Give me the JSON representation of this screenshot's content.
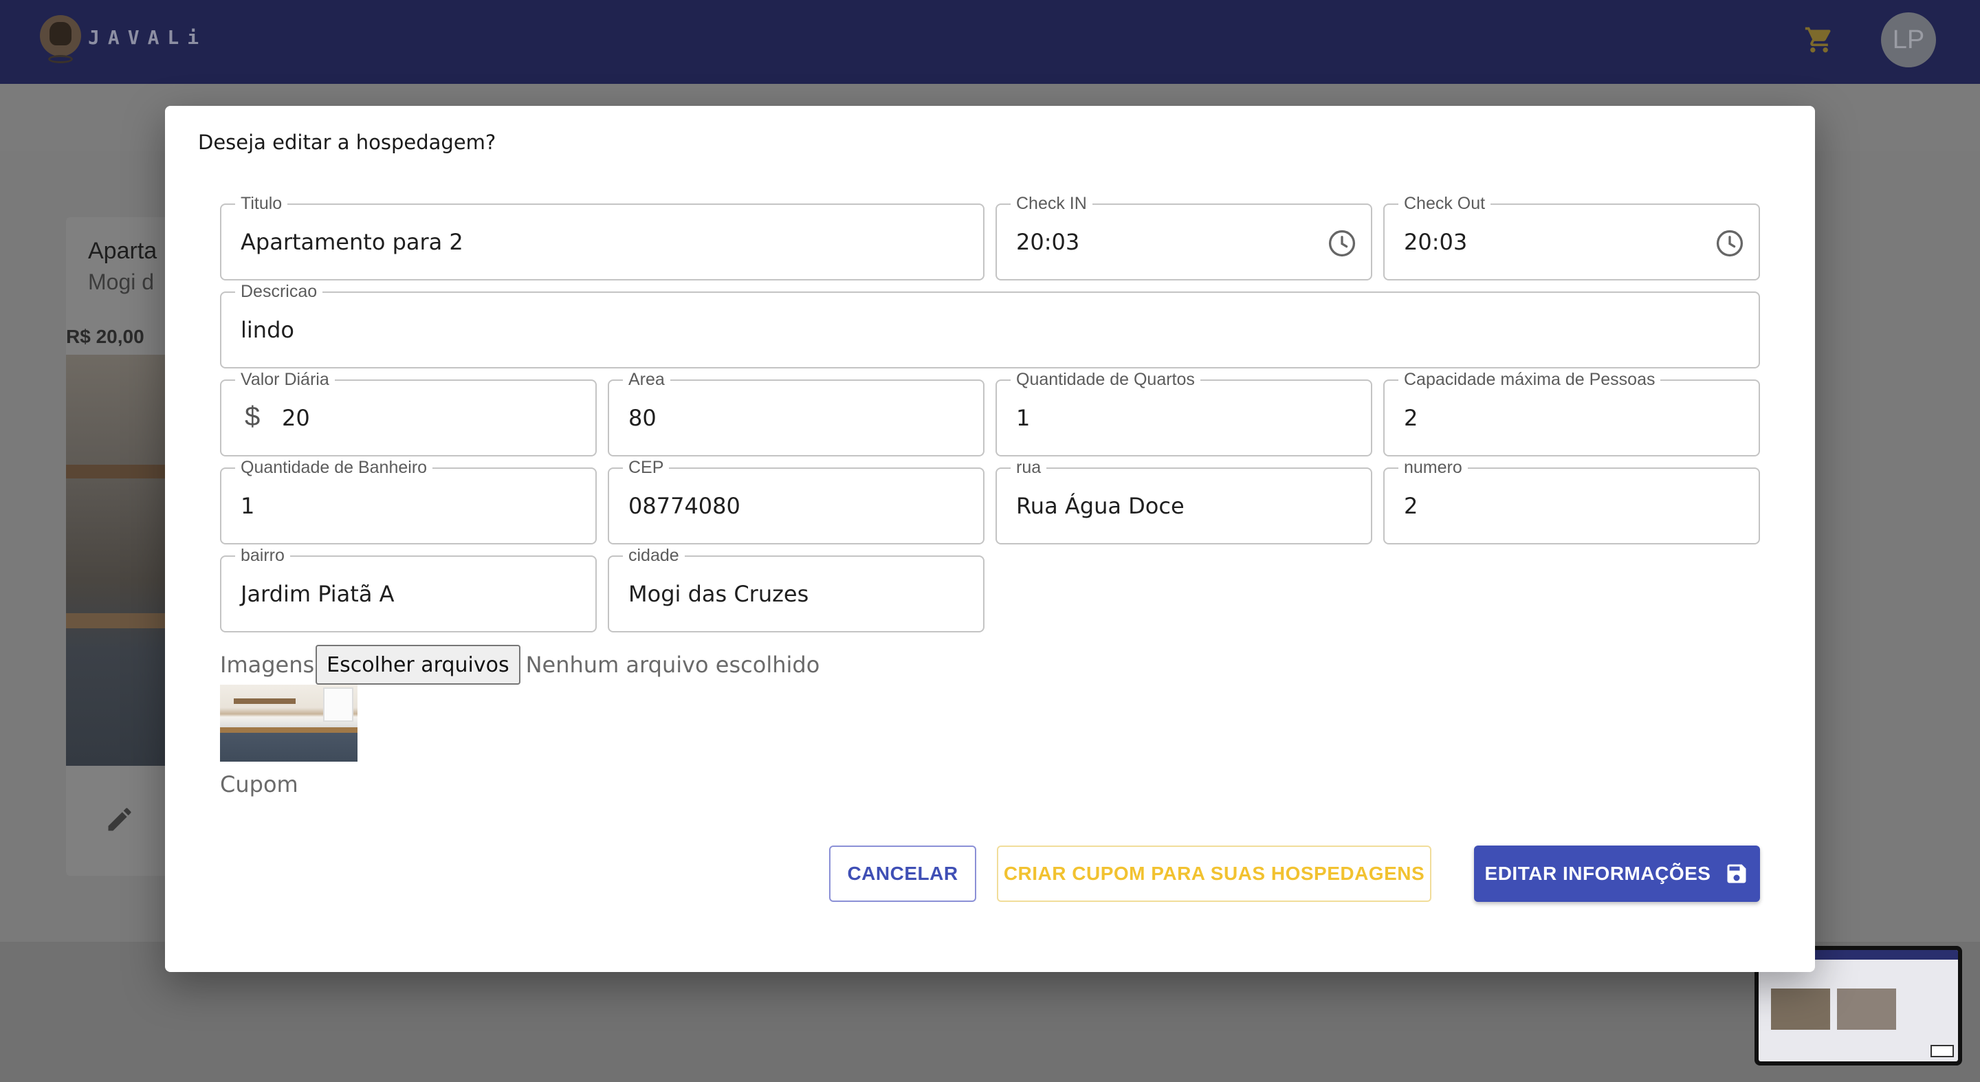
{
  "header": {
    "brand": "JAVALi",
    "avatar_initials": "LP",
    "icons": [
      "cart-icon"
    ]
  },
  "background_card": {
    "title": "Aparta",
    "subtitle": "Mogi d",
    "price": "R$ 20,00"
  },
  "dialog": {
    "title": "Deseja editar a hospedagem?",
    "fields": {
      "titulo": {
        "label": "Titulo",
        "value": "Apartamento para 2"
      },
      "check_in": {
        "label": "Check IN",
        "value": "20:03"
      },
      "check_out": {
        "label": "Check Out",
        "value": "20:03"
      },
      "descricao": {
        "label": "Descricao",
        "value": "lindo"
      },
      "valor_diaria": {
        "label": "Valor Diária",
        "prefix": "$",
        "value": "20"
      },
      "area": {
        "label": "Area",
        "value": "80"
      },
      "quartos": {
        "label": "Quantidade de Quartos",
        "value": "1"
      },
      "capacidade": {
        "label": "Capacidade máxima de Pessoas",
        "value": "2"
      },
      "banheiros": {
        "label": "Quantidade de Banheiro",
        "value": "1"
      },
      "cep": {
        "label": "CEP",
        "value": "08774080"
      },
      "rua": {
        "label": "rua",
        "value": "Rua Água Doce"
      },
      "numero": {
        "label": "numero",
        "value": "2"
      },
      "bairro": {
        "label": "bairro",
        "value": "Jardim Piatã A"
      },
      "cidade": {
        "label": "cidade",
        "value": "Mogi das Cruzes"
      }
    },
    "images": {
      "label": "Imagens",
      "button": "Escolher arquivos",
      "status": "Nenhum arquivo escolhido"
    },
    "cupom_label": "Cupom",
    "buttons": {
      "cancel": "CANCELAR",
      "create_coupon": "CRIAR CUPOM PARA SUAS HOSPEDAGENS",
      "edit": "EDITAR INFORMAÇÕES"
    }
  },
  "colors": {
    "appbar": "#20234f",
    "primary": "#3f4fb5",
    "warning": "#f2c230"
  }
}
